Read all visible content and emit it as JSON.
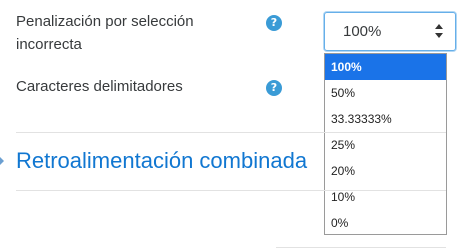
{
  "fields": {
    "penalty_label": "Penalización por selección incorrecta",
    "delimiters_label": "Caracteres delimitadores"
  },
  "penalty_select": {
    "value": "100%",
    "options": [
      "100%",
      "50%",
      "33.33333%",
      "25%",
      "20%",
      "10%",
      "0%"
    ],
    "selected_index": 0
  },
  "section": {
    "title": "Retroalimentación combinada"
  },
  "icons": {
    "help": "question-circle-icon",
    "select_arrows": "sort-arrows-icon",
    "section_toggle": "caret-right-icon"
  },
  "colors": {
    "accent": "#1177d1",
    "help": "#3a9bd6",
    "selected_option": "#1a73e8"
  }
}
